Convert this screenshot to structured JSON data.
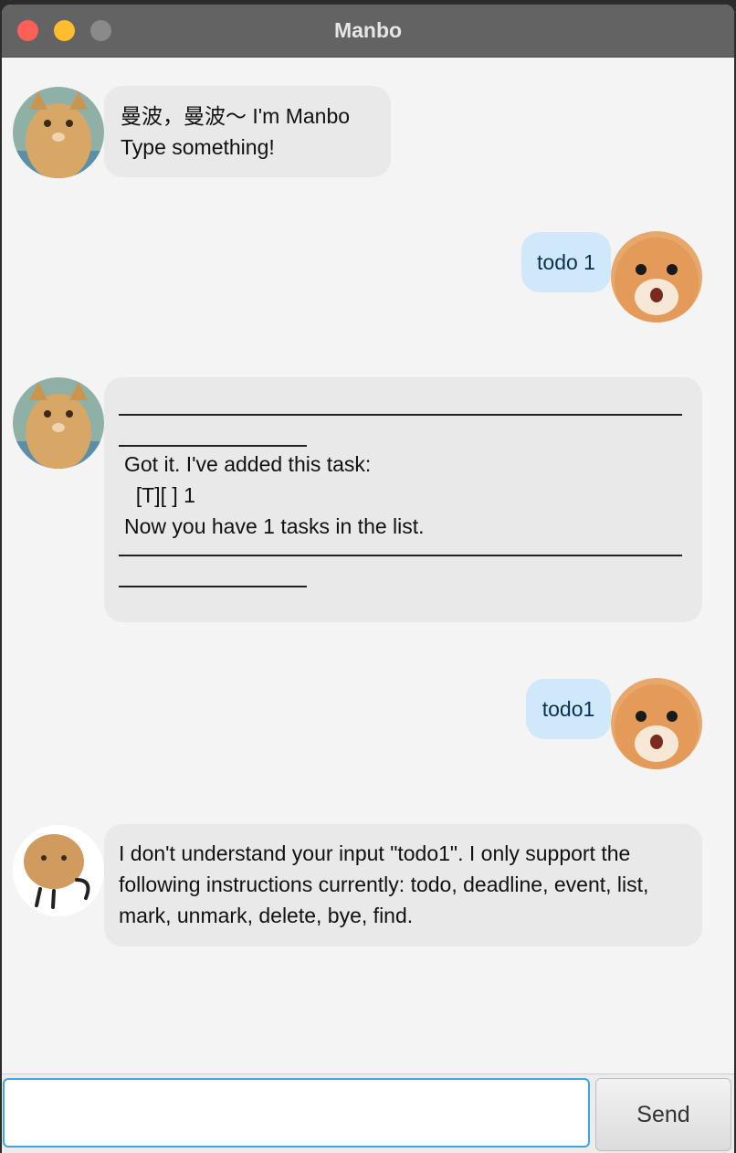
{
  "window": {
    "title": "Manbo"
  },
  "messages": [
    {
      "sender": "bot",
      "avatar": "cat-avatar",
      "lines": [
        "曼波，曼波～ I'm Manbo",
        "Type something!"
      ]
    },
    {
      "sender": "user",
      "avatar": "hamster-avatar",
      "text": "todo 1"
    },
    {
      "sender": "bot",
      "avatar": "cat-avatar",
      "lines": [
        "Got it. I've added this task:",
        "  [T][ ] 1",
        "Now you have 1 tasks in the list."
      ]
    },
    {
      "sender": "user",
      "avatar": "hamster-avatar",
      "text": "todo1"
    },
    {
      "sender": "bot",
      "avatar": "cat-sticker-avatar",
      "lines": [
        "I don't understand your input \"todo1\". I only support the",
        "following instructions currently: todo, deadline, event, list,",
        "mark, unmark, delete, bye, find."
      ]
    }
  ],
  "input": {
    "value": "",
    "placeholder": ""
  },
  "send_label": "Send",
  "colors": {
    "user_bubble": "#cfe9fb",
    "bot_bubble": "#e9e9e9",
    "input_focus": "#3ba5e6"
  }
}
